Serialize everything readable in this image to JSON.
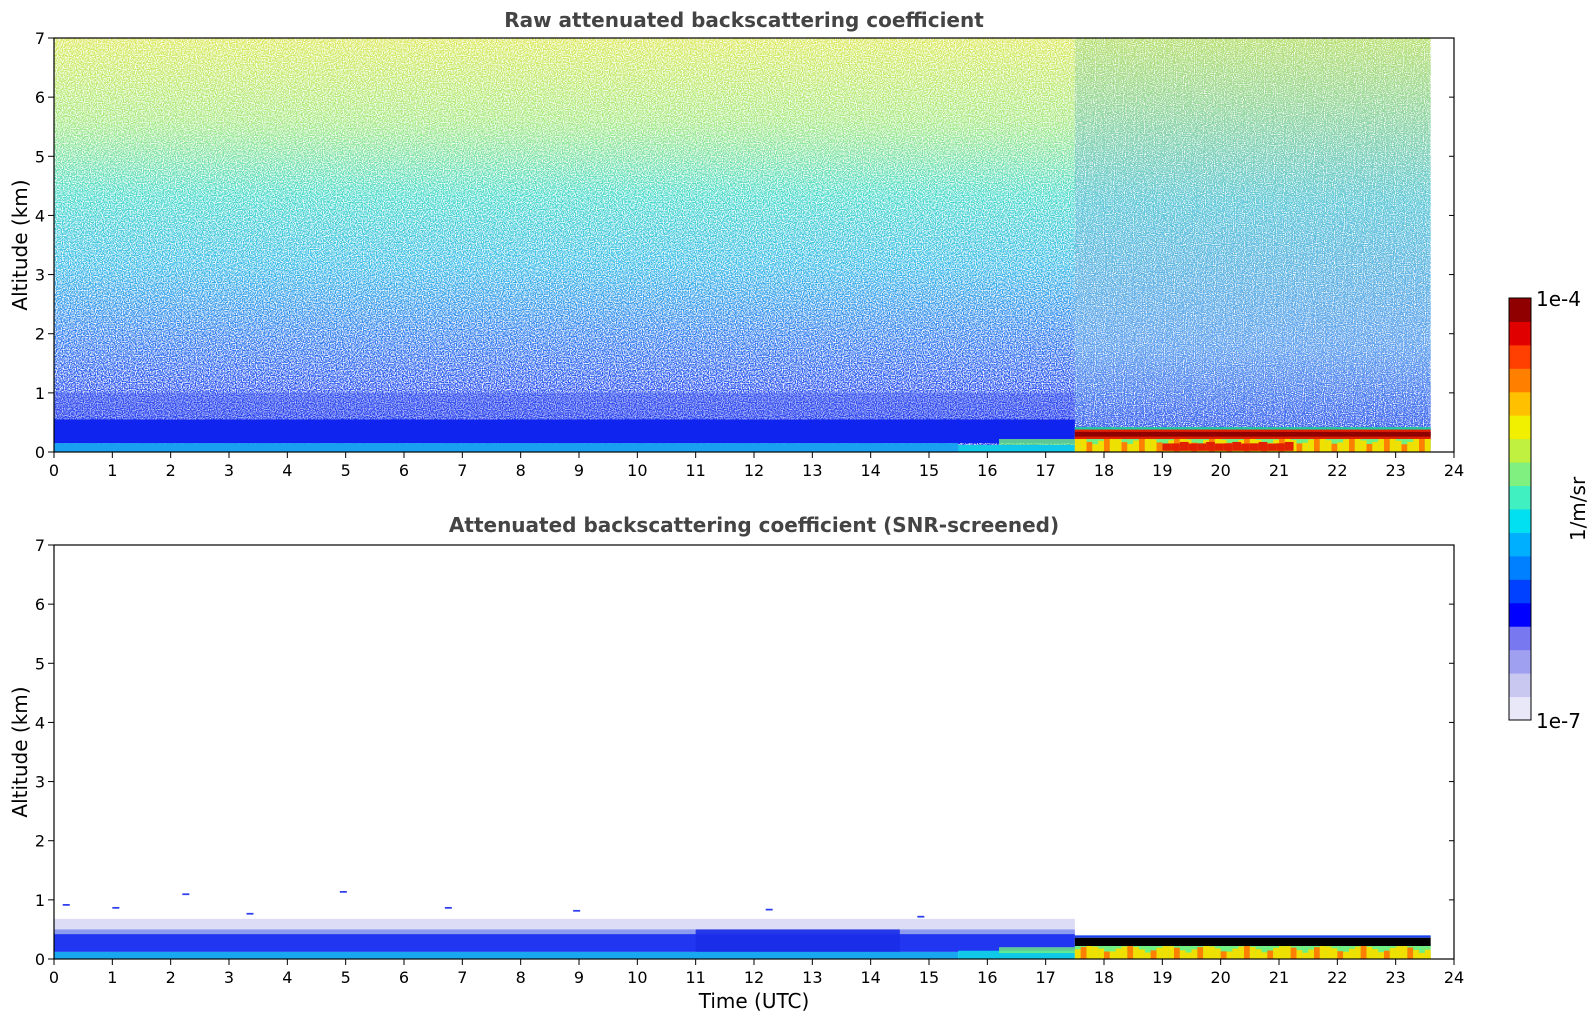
{
  "chart_data": [
    {
      "type": "heatmap",
      "title": "Raw attenuated backscattering coefficient",
      "xlabel": "",
      "ylabel": "Altitude (km)",
      "xlim": [
        0,
        24
      ],
      "ylim": [
        0,
        7
      ],
      "x_ticks": [
        0,
        1,
        2,
        3,
        4,
        5,
        6,
        7,
        8,
        9,
        10,
        11,
        12,
        13,
        14,
        15,
        16,
        17,
        18,
        19,
        20,
        21,
        22,
        23,
        24
      ],
      "y_ticks": [
        0,
        1,
        2,
        3,
        4,
        5,
        6,
        7
      ],
      "data_end_time": 23.6,
      "layers": [
        {
          "time": [
            0,
            15.5
          ],
          "altitude_km": [
            0,
            0.15
          ],
          "level": "mid (cyan)"
        },
        {
          "time": [
            0,
            17.5
          ],
          "altitude_km": [
            0.15,
            0.5
          ],
          "level": "low (blue)"
        },
        {
          "time": [
            15.5,
            17.5
          ],
          "altitude_km": [
            0,
            0.25
          ],
          "level": "mid (cyan/green)"
        },
        {
          "time": [
            17.5,
            23.6
          ],
          "altitude_km": [
            0,
            0.3
          ],
          "level": "high (yellow/orange/red)"
        },
        {
          "time": [
            17.5,
            23.6
          ],
          "altitude_km": [
            0.25,
            0.4
          ],
          "level": "highest (dark red)"
        }
      ],
      "noise": "speckled noise increasing with altitude: blue near 0-2 km, cyan/green at 3-5 km, yellow-green at 6-7 km; sparser after 17.5 h"
    },
    {
      "type": "heatmap",
      "title": "Attenuated backscattering coefficient (SNR-screened)",
      "xlabel": "Time (UTC)",
      "ylabel": "Altitude (km)",
      "xlim": [
        0,
        24
      ],
      "ylim": [
        0,
        7
      ],
      "x_ticks": [
        0,
        1,
        2,
        3,
        4,
        5,
        6,
        7,
        8,
        9,
        10,
        11,
        12,
        13,
        14,
        15,
        16,
        17,
        18,
        19,
        20,
        21,
        22,
        23,
        24
      ],
      "y_ticks": [
        0,
        1,
        2,
        3,
        4,
        5,
        6,
        7
      ],
      "data_end_time": 23.6,
      "layers": [
        {
          "time": [
            0,
            17.5
          ],
          "altitude_km": [
            0,
            0.15
          ],
          "level": "mid (cyan)"
        },
        {
          "time": [
            0,
            17.5
          ],
          "altitude_km": [
            0.15,
            0.45
          ],
          "level": "low (blue)"
        },
        {
          "time": [
            0,
            17.5
          ],
          "altitude_km": [
            0.45,
            0.65
          ],
          "level": "lowest (pale blue)"
        },
        {
          "time": [
            17.5,
            23.6
          ],
          "altitude_km": [
            0,
            0.25
          ],
          "level": "high (yellow/orange)"
        },
        {
          "time": [
            17.5,
            23.6
          ],
          "altitude_km": [
            0.25,
            0.35
          ],
          "level": "black (masked)"
        }
      ]
    }
  ],
  "colorbar": {
    "label": "1/m/sr",
    "min_label": "1e-7",
    "max_label": "1e-4",
    "colors": [
      "#e8e8f8",
      "#c8c8f0",
      "#a0a0f0",
      "#7878f0",
      "#0000ff",
      "#0040ff",
      "#0080ff",
      "#00b0ff",
      "#00e0f0",
      "#40f0c0",
      "#80f080",
      "#c0f040",
      "#f0f000",
      "#ffc000",
      "#ff8000",
      "#ff4000",
      "#e00000",
      "#900000"
    ]
  }
}
